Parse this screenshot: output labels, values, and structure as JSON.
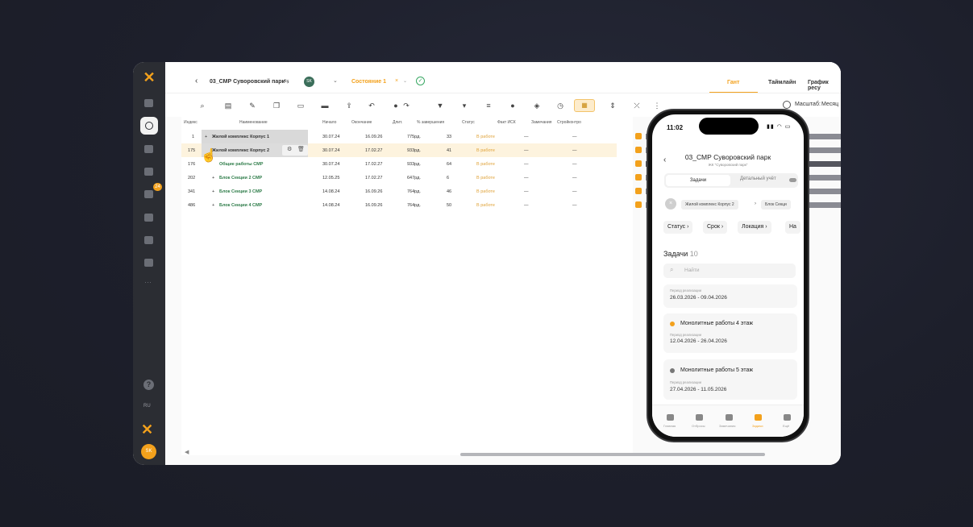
{
  "header": {
    "back_glyph": "‹",
    "project_title": "03_СМР Суворовский парк",
    "swap_glyph": "⇆",
    "user_initials": "SK",
    "state_label": "Состояние 1",
    "state_close": "×",
    "state_chevron": "⌄",
    "chevron": "⌄",
    "ok_glyph": "✓"
  },
  "tabs": [
    {
      "label": "Гант",
      "active": true
    },
    {
      "label": "Таймлайн",
      "active": false
    },
    {
      "label": "График ресу",
      "active": false
    }
  ],
  "toolbar": {
    "scale_label": "Масштаб:",
    "scale_value": "Месяц"
  },
  "rail": {
    "badge": "24",
    "lang": "RU",
    "avatar": "SK"
  },
  "table": {
    "columns": [
      "Индекс",
      "Наименование",
      "Начало",
      "Окончание",
      "Длит.",
      "% завершения",
      "Статус",
      "Факт ИСК",
      "Замечания",
      "Стройконтро"
    ],
    "rows": [
      {
        "index": "1",
        "name": "Жилой комплекс Корпус 1",
        "start": "30.07.24",
        "end": "16.09.26",
        "dur": "775рд.",
        "pct": "33",
        "status": "В работе",
        "fact": "—",
        "notes": "—"
      },
      {
        "index": "175",
        "name": "Жилой комплекс Корпус 2",
        "start": "30.07.24",
        "end": "17.02.27",
        "dur": "933рд.",
        "pct": "41",
        "status": "В работе",
        "fact": "—",
        "notes": "—"
      },
      {
        "index": "176",
        "name": "Общие работы СМР",
        "start": "30.07.24",
        "end": "17.02.27",
        "dur": "933рд.",
        "pct": "64",
        "status": "В работе",
        "fact": "—",
        "notes": "—"
      },
      {
        "index": "202",
        "name": "Блок Секции 2 СМР",
        "start": "12.05.25",
        "end": "17.02.27",
        "dur": "647рд.",
        "pct": "6",
        "status": "В работе",
        "fact": "—",
        "notes": "—"
      },
      {
        "index": "341",
        "name": "Блок Секции 3 СМР",
        "start": "14.08.24",
        "end": "16.09.26",
        "dur": "764рд.",
        "pct": "46",
        "status": "В работе",
        "fact": "—",
        "notes": "—"
      },
      {
        "index": "486",
        "name": "Блок Секции 4 СМР",
        "start": "14.08.24",
        "end": "16.09.26",
        "dur": "764рд.",
        "pct": "50",
        "status": "В работе",
        "fact": "—",
        "notes": "—"
      }
    ]
  },
  "phone": {
    "time": "11:02",
    "status_icons": "▮▮ ◠ ▭",
    "title": "03_СМР Суворовский парк",
    "subtitle": "ЖК \"Суворовский парк\"",
    "seg_active": "Задачи",
    "seg_inactive": "Детальный учёт",
    "close_glyph": "×",
    "crumbs": [
      "Жилой комплекс Корпус 2",
      "Блок Секци"
    ],
    "crumb_arrow": "›",
    "filters": [
      "Статус ›",
      "Срок ›",
      "Локация ›",
      "На"
    ],
    "tasks_label": "Задачи",
    "tasks_count": "10",
    "search_placeholder": "Найти",
    "cards": [
      {
        "title": "",
        "period_label": "Период реализации",
        "dates": "26.03.2026 - 09.04.2026",
        "dot_color": ""
      },
      {
        "title": "Монолитные работы 4 этаж",
        "period_label": "Период реализации",
        "dates": "12.04.2026 - 26.04.2026",
        "dot_color": "#f3a11c"
      },
      {
        "title": "Монолитные работы 5 этаж",
        "period_label": "Период реализации",
        "dates": "27.04.2026 - 11.05.2026",
        "dot_color": "#777777"
      }
    ],
    "nav": [
      {
        "label": "Главная",
        "active": false
      },
      {
        "label": "Отбросы",
        "active": false
      },
      {
        "label": "Замечания",
        "active": false
      },
      {
        "label": "Задачи",
        "active": true
      },
      {
        "label": "Ещё",
        "active": false
      }
    ]
  },
  "colors": {
    "accent": "#f3a11c",
    "rail": "#2b2d33",
    "success": "#3aa864"
  }
}
